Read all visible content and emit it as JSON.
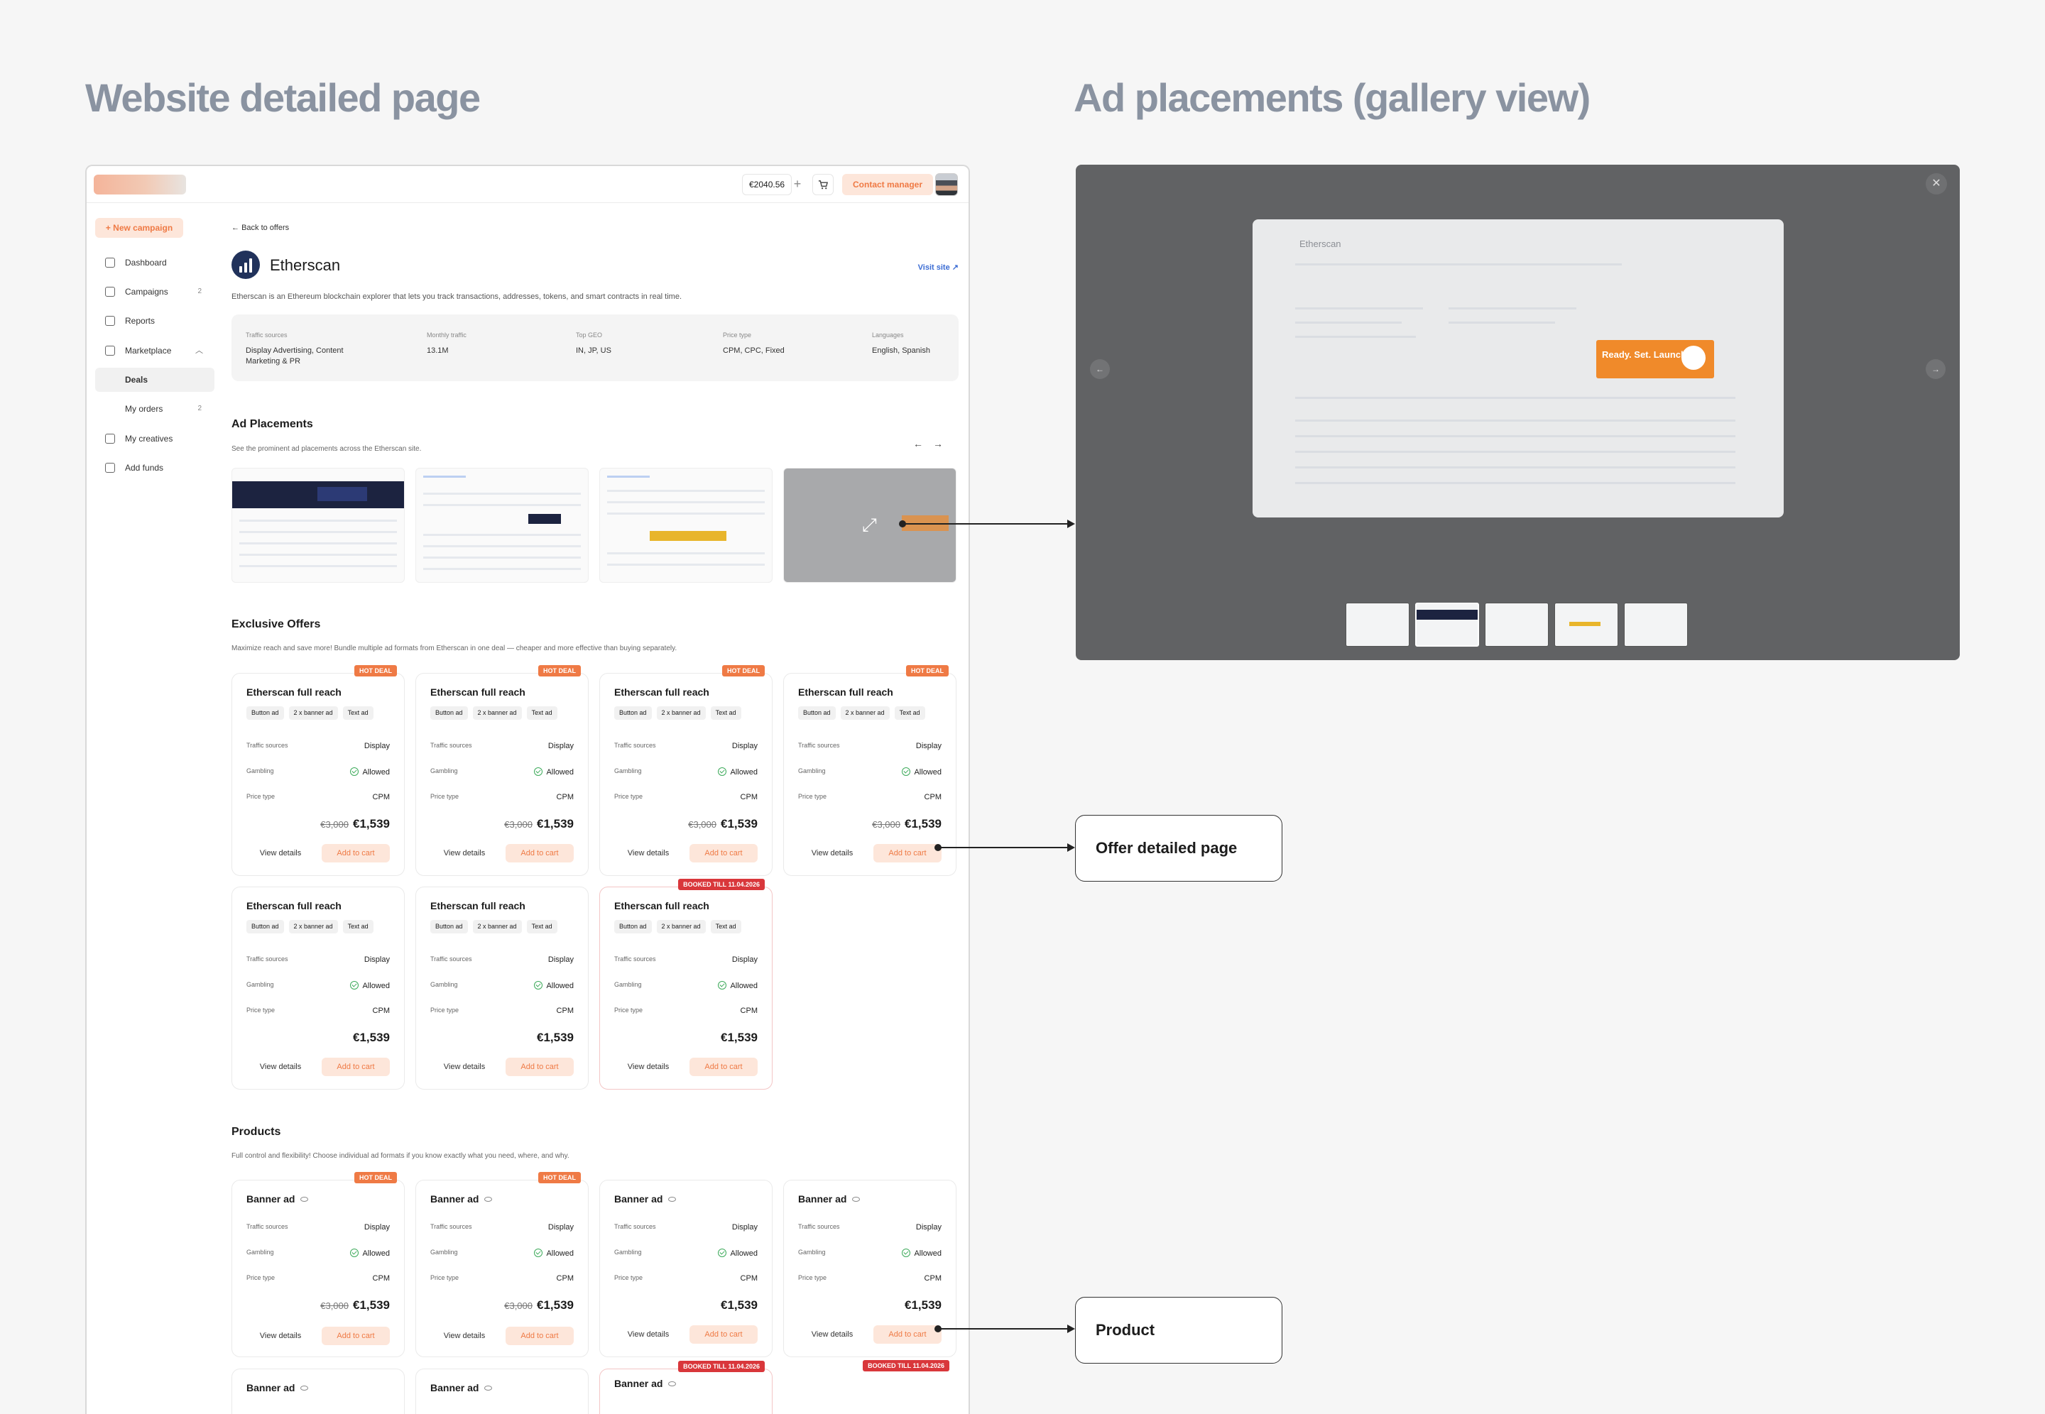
{
  "headings": {
    "left": "Website detailed page",
    "right": "Ad placements (gallery view)"
  },
  "topbar": {
    "balance": "€2040.56",
    "contact": "Contact manager"
  },
  "sidebar": {
    "new_campaign": "New campaign",
    "items": [
      {
        "label": "Dashboard",
        "icon": "dashboard-icon",
        "badge": ""
      },
      {
        "label": "Campaigns",
        "icon": "campaigns-icon",
        "badge": "2"
      },
      {
        "label": "Reports",
        "icon": "reports-icon",
        "badge": ""
      },
      {
        "label": "Marketplace",
        "icon": "marketplace-icon",
        "badge": ""
      },
      {
        "label": "Deals",
        "icon": "",
        "badge": ""
      },
      {
        "label": "My orders",
        "icon": "",
        "badge": "2"
      },
      {
        "label": "My creatives",
        "icon": "creatives-icon",
        "badge": ""
      },
      {
        "label": "Add funds",
        "icon": "card-icon",
        "badge": ""
      }
    ]
  },
  "site": {
    "back": "Back to offers",
    "name": "Etherscan",
    "visit": "Visit site",
    "description": "Etherscan is an Ethereum blockchain explorer that lets you track transactions, addresses, tokens, and smart contracts in real time.",
    "info": [
      {
        "k": "Traffic sources",
        "v": "Display Advertising, Content Marketing & PR"
      },
      {
        "k": "Monthly traffic",
        "v": "13.1M"
      },
      {
        "k": "Top GEO",
        "v": "IN, JP, US"
      },
      {
        "k": "Price type",
        "v": "CPM, CPC, Fixed"
      },
      {
        "k": "Languages",
        "v": "English, Spanish"
      }
    ]
  },
  "placements": {
    "title": "Ad Placements",
    "subtitle": "See the prominent ad placements across the Etherscan site."
  },
  "offers": {
    "title": "Exclusive Offers",
    "subtitle": "Maximize reach and save more! Bundle multiple ad formats from Etherscan in one deal — cheaper and more effective than buying separately.",
    "cards": [
      {
        "ribbon": "HOT DEAL",
        "type": "hot",
        "title": "Etherscan full reach",
        "old": "€3,000",
        "price": "€1,539"
      },
      {
        "ribbon": "HOT DEAL",
        "type": "hot",
        "title": "Etherscan full reach",
        "old": "€3,000",
        "price": "€1,539"
      },
      {
        "ribbon": "HOT DEAL",
        "type": "hot",
        "title": "Etherscan full reach",
        "old": "€3,000",
        "price": "€1,539"
      },
      {
        "ribbon": "HOT DEAL",
        "type": "hot",
        "title": "Etherscan full reach",
        "old": "€3,000",
        "price": "€1,539"
      },
      {
        "ribbon": "",
        "type": "",
        "title": "Etherscan full reach",
        "old": "",
        "price": "€1,539"
      },
      {
        "ribbon": "",
        "type": "",
        "title": "Etherscan full reach",
        "old": "",
        "price": "€1,539"
      },
      {
        "ribbon": "BOOKED TILL 11.04.2026",
        "type": "booked",
        "title": "Etherscan full reach",
        "old": "",
        "price": "€1,539"
      }
    ]
  },
  "products": {
    "title": "Products",
    "subtitle": "Full control and flexibility! Choose individual ad formats if you know exactly what you need, where, and why.",
    "cards": [
      {
        "ribbon": "HOT DEAL",
        "type": "hot",
        "title": "Banner ad",
        "old": "€3,000",
        "price": "€1,539"
      },
      {
        "ribbon": "HOT DEAL",
        "type": "hot",
        "title": "Banner ad",
        "old": "€3,000",
        "price": "€1,539"
      },
      {
        "ribbon": "",
        "type": "",
        "title": "Banner ad",
        "old": "",
        "price": "€1,539"
      },
      {
        "ribbon": "",
        "type": "",
        "title": "Banner ad",
        "old": "",
        "price": "€1,539"
      },
      {
        "ribbon": "",
        "type": "",
        "title": "Banner ad",
        "old": "",
        "price": ""
      },
      {
        "ribbon": "",
        "type": "",
        "title": "Banner ad",
        "old": "",
        "price": ""
      },
      {
        "ribbon": "BOOKED TILL 11.04.2026",
        "type": "booked",
        "title": "Banner ad",
        "old": "",
        "price": ""
      },
      {
        "ribbon": "BOOKED TILL 11.04.2026",
        "type": "booked",
        "title": "",
        "old": "",
        "price": ""
      }
    ]
  },
  "card_common": {
    "chips": [
      "Button ad",
      "2 x banner ad",
      "Text ad"
    ],
    "traffic_label": "Traffic sources",
    "traffic_value": "Display",
    "gambling_label": "Gambling",
    "gambling_value": "Allowed",
    "price_type_label": "Price type",
    "price_type_value": "CPM",
    "view": "View details",
    "add": "Add to cart"
  },
  "gallery": {
    "ad_text": "Ready. Set. Launch!",
    "site": "Etherscan"
  },
  "callouts": {
    "offer": "Offer detailed page",
    "product": "Product"
  },
  "colors": {
    "accent": "#ef7a45",
    "accent_bg": "#fde6da",
    "booked": "#d9373b",
    "link": "#3b6cd4"
  }
}
